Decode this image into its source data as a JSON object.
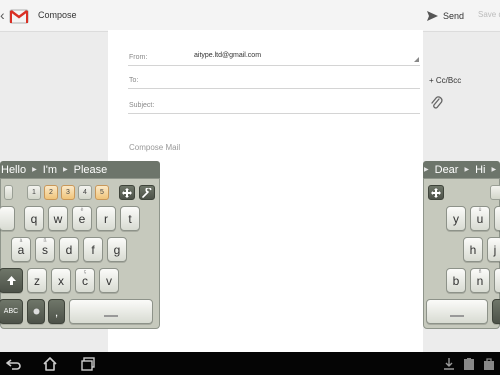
{
  "topbar": {
    "back_glyph": "‹",
    "app_title": "Compose",
    "send_label": "Send",
    "save_label": "Save d"
  },
  "compose": {
    "from_label": "From:",
    "from_value": "aitype.ltd@gmail.com",
    "to_label": "To:",
    "subject_label": "Subject:",
    "cc_bcc_label": "+ Cc/Bcc",
    "body_placeholder": "Compose Mail"
  },
  "keyboard_left": {
    "suggestions": [
      "Hello",
      "I'm",
      "Please"
    ],
    "number_keys": [
      "1",
      "2",
      "3",
      "4",
      "5"
    ],
    "row1": [
      {
        "main": "q",
        "alt": ""
      },
      {
        "main": "w",
        "alt": ""
      },
      {
        "main": "e",
        "alt": "è"
      },
      {
        "main": "r",
        "alt": ""
      },
      {
        "main": "t",
        "alt": ""
      }
    ],
    "row2": [
      {
        "main": "a",
        "alt": "à"
      },
      {
        "main": "s",
        "alt": "ß"
      },
      {
        "main": "d",
        "alt": ""
      },
      {
        "main": "f",
        "alt": ""
      },
      {
        "main": "g",
        "alt": ""
      }
    ],
    "row3": [
      {
        "main": "z",
        "alt": ""
      },
      {
        "main": "x",
        "alt": ""
      },
      {
        "main": "c",
        "alt": "ç"
      },
      {
        "main": "v",
        "alt": ""
      }
    ],
    "abc_label": "ABC",
    "comma_label": ","
  },
  "keyboard_right": {
    "suggestions": [
      "Dear",
      "Hi"
    ],
    "row1": [
      {
        "main": "y",
        "alt": ""
      },
      {
        "main": "u",
        "alt": "ü"
      }
    ],
    "row2": [
      {
        "main": "h",
        "alt": ""
      },
      {
        "main": "j",
        "alt": ""
      }
    ],
    "row3": [
      {
        "main": "b",
        "alt": ""
      },
      {
        "main": "n",
        "alt": "ñ"
      }
    ]
  },
  "colors": {
    "suggestion_bar": "#6d756b",
    "keyboard_body": "#c6c9bd",
    "navbar": "#050505"
  }
}
